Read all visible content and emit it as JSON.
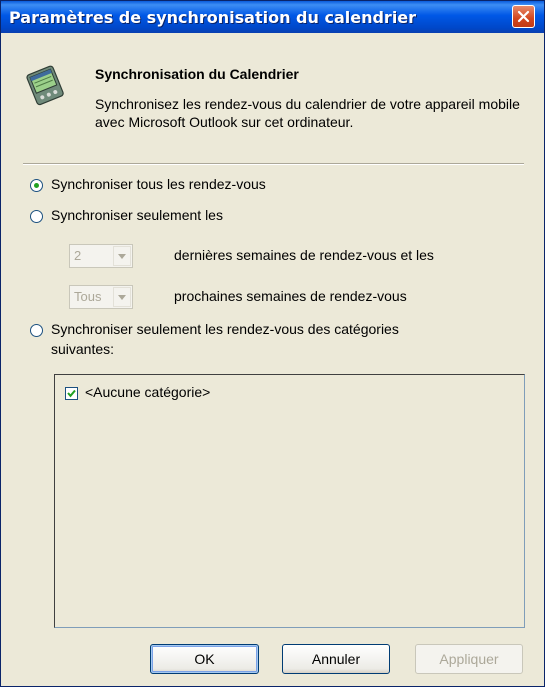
{
  "window": {
    "title": "Paramètres de synchronisation du calendrier"
  },
  "header": {
    "title": "Synchronisation du Calendrier",
    "description": "Synchronisez les rendez-vous du calendrier de votre appareil mobile avec Microsoft Outlook sur cet ordinateur.",
    "icon": "handheld-calendar-icon"
  },
  "options": {
    "all_label": "Synchroniser tous les rendez-vous",
    "all_checked": true,
    "only_label": "Synchroniser seulement les",
    "only_checked": false,
    "past_weeks_value": "2",
    "past_weeks_suffix": "dernières semaines de rendez-vous et les",
    "future_weeks_value": "Tous",
    "future_weeks_suffix": "prochaines semaines de rendez-vous",
    "categories_label_line1": "Synchroniser seulement les rendez-vous des catégories",
    "categories_label_line2": "suivantes:",
    "categories_checked": false
  },
  "categories": [
    {
      "label": "<Aucune catégorie>",
      "checked": true
    }
  ],
  "buttons": {
    "ok": "OK",
    "cancel": "Annuler",
    "apply": "Appliquer"
  },
  "colors": {
    "titlebar": "#0058e6",
    "dialog_bg": "#ece9d8",
    "close_button": "#d2461e"
  }
}
